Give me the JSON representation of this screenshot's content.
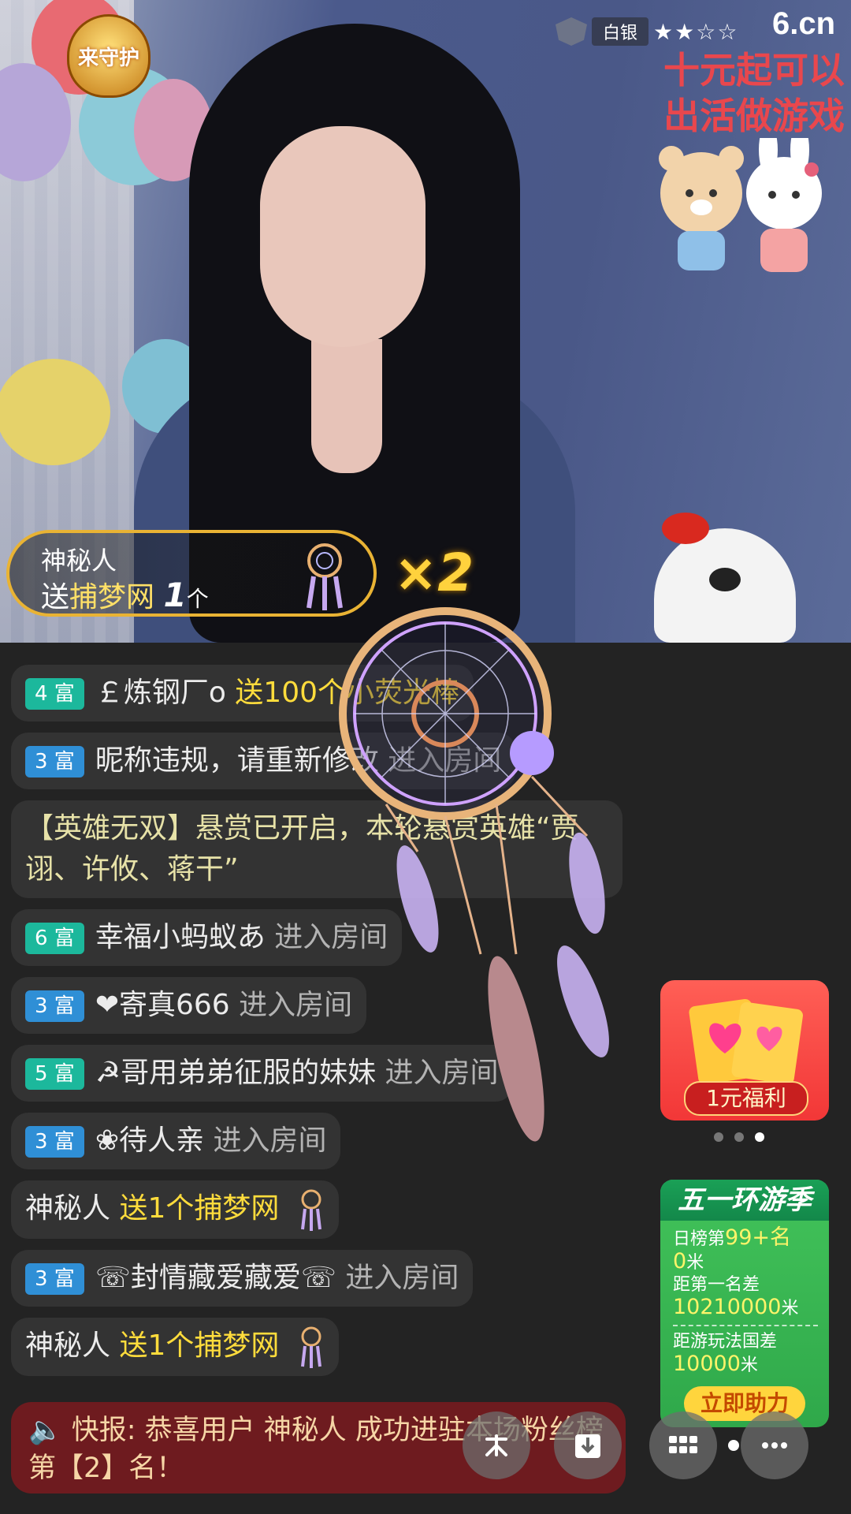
{
  "video": {
    "guard_badge": "来守护",
    "rank_name": "白银",
    "stars": "★★☆☆",
    "logo": "6.cn",
    "promo_line1": "十元起可以",
    "promo_line2": "出活做游戏"
  },
  "gift_banner": {
    "sender": "神秘人",
    "verb": "送",
    "gift_name": "捕梦网",
    "count": "1",
    "unit": "个",
    "multiplier": "×2"
  },
  "chat": [
    {
      "badge": "4 富",
      "level": 4,
      "name": "￡炼钢厂o",
      "action": "送100个小荧光棒"
    },
    {
      "badge": "3 富",
      "level": 3,
      "name": "昵称违规，请重新修改",
      "action": "进入房间"
    },
    {
      "text": "【英雄无双】悬赏已开启，本轮悬赏英雄“贾诩、许攸、蒋干”"
    },
    {
      "badge": "6 富",
      "level": 6,
      "name": "幸福小蚂蚁あ",
      "action": "进入房间"
    },
    {
      "badge": "3 富",
      "level": 3,
      "name": "❤寄真666",
      "action": "进入房间"
    },
    {
      "badge": "5 富",
      "level": 5,
      "name": "☭哥用弟弟征服的妹妹",
      "action": "进入房间"
    },
    {
      "badge": "3 富",
      "level": 3,
      "name": "❀待人亲",
      "action": "进入房间"
    },
    {
      "name": "神秘人",
      "gift": "送1个捕梦网"
    },
    {
      "badge": "3 富",
      "level": 3,
      "name": "☏封情藏爱藏爱☏",
      "action": "进入房间"
    },
    {
      "name": "神秘人",
      "gift": "送1个捕梦网"
    }
  ],
  "news": {
    "icon": "speaker-icon",
    "text": "快报: 恭喜用户 神秘人 成功进驻本场粉丝榜第【2】名！"
  },
  "side_promo": {
    "label": "1元福利",
    "carousel_active": 3,
    "carousel_total": 3
  },
  "event": {
    "title": "五一环游季",
    "rank_label": "日榜第",
    "rank_value": "99+名",
    "distance_value": "0",
    "distance_unit": "米",
    "first_label": "距第一名差",
    "first_value": "10210000",
    "first_unit": "米",
    "nation_label": "距游玩法国差",
    "nation_value": "10000",
    "nation_unit": "米",
    "button": "立即助力"
  },
  "toolbar": {
    "icons": [
      "gift-fan-icon",
      "download-icon",
      "grid-icon",
      "more-icon"
    ]
  },
  "colors": {
    "rich_badge_green": "#1cb89c",
    "rich_badge_blue": "#2f8fd6",
    "gift_yellow": "#ffdc3c",
    "news_bg": "#6e1b1f"
  }
}
